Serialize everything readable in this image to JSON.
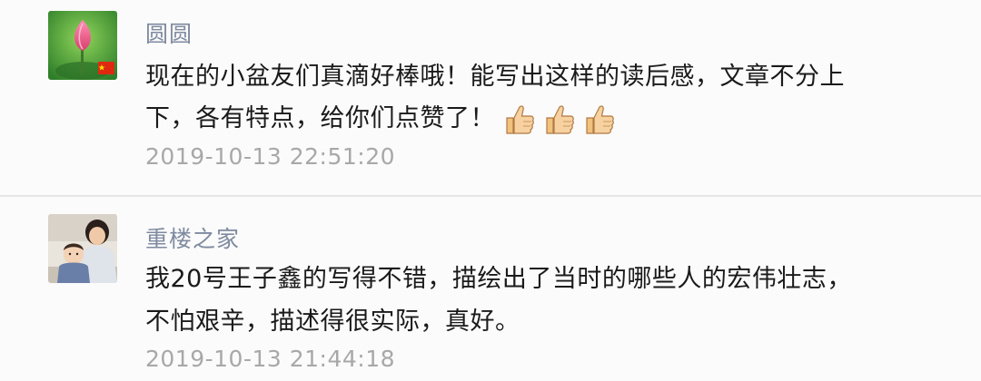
{
  "comments": [
    {
      "name": "圆圆",
      "text_line1": "现在的小盆友们真滴好棒哦！能写出这样的读后感，文章不分上",
      "text_line2": "下，各有特点，给你们点赞了！",
      "emoji": [
        "thumbs-up",
        "thumbs-up",
        "thumbs-up"
      ],
      "timestamp": "2019-10-13 22:51:20"
    },
    {
      "name": "重楼之家",
      "text_line1": "我20号王子鑫的写得不错，描绘出了当时的哪些人的宏伟壮志，",
      "text_line2": "不怕艰辛，描述得很实际，真好。",
      "timestamp": "2019-10-13 21:44:18"
    }
  ]
}
